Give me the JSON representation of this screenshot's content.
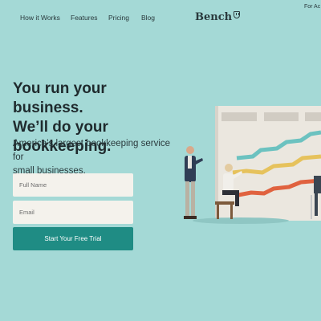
{
  "nav": {
    "links": [
      "How it Works",
      "Features",
      "Pricing",
      "Blog"
    ],
    "logo": "Bench",
    "accountants": "For Ac"
  },
  "hero": {
    "headline": [
      "You run your business.",
      "We’ll do your",
      "bookkeeping."
    ],
    "subhead": [
      "America’s largest bookkeeping service for",
      "small businesses."
    ]
  },
  "form": {
    "name_placeholder": "Full Name",
    "email_placeholder": "Email",
    "cta_label": "Start Your Free Trial"
  },
  "colors": {
    "background": "#a4d9d6",
    "cta": "#1f8c84",
    "field": "#f4f2ec",
    "text": "#1f2a2d"
  }
}
